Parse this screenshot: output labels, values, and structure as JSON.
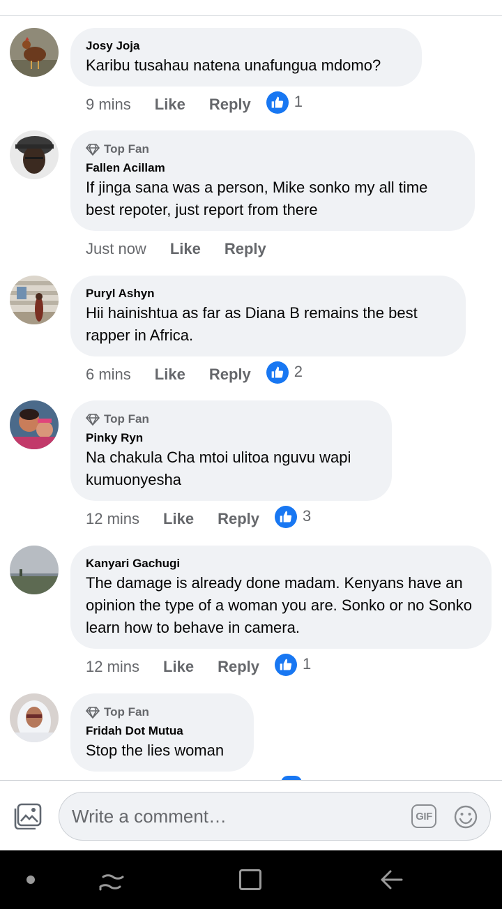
{
  "comments": [
    {
      "author": "Josy Joja",
      "text": "Karibu tusahau natena unafungua mdomo?",
      "time": "9 mins",
      "like": "Like",
      "reply": "Reply",
      "reactions": "1"
    },
    {
      "badge": "Top Fan",
      "author": "Fallen Acillam",
      "text": "If jinga sana was a person, Mike sonko my all time best repoter, just report from there",
      "time": "Just now",
      "like": "Like",
      "reply": "Reply"
    },
    {
      "author": "Puryl Ashyn",
      "text": "Hii hainishtua as far as  Diana B remains the best rapper in Africa.",
      "time": "6 mins",
      "like": "Like",
      "reply": "Reply",
      "reactions": "2"
    },
    {
      "badge": "Top Fan",
      "author": "Pinky Ryn",
      "text": "Na chakula Cha mtoi ulitoa nguvu wapi kumuonyesha",
      "time": "12 mins",
      "like": "Like",
      "reply": "Reply",
      "reactions": "3"
    },
    {
      "author": "Kanyari Gachugi",
      "text": "The damage is already done madam. Kenyans have an opinion the type of a woman you are. Sonko or no Sonko learn how to behave in camera.",
      "time": "12 mins",
      "like": "Like",
      "reply": "Reply",
      "reactions": "1"
    },
    {
      "badge": "Top Fan",
      "author": "Fridah Dot Mutua",
      "text": "Stop the lies woman"
    }
  ],
  "composer": {
    "placeholder": "Write a comment…",
    "gif": "GIF"
  },
  "colors": {
    "accent": "#1877f2",
    "bubble": "#f0f2f5",
    "meta": "#65676b"
  },
  "icons": [
    "photo-icon",
    "gif-icon",
    "emoji-icon",
    "diamond-icon",
    "like-icon",
    "nav-recents-icon",
    "nav-home-icon",
    "nav-back-icon"
  ]
}
